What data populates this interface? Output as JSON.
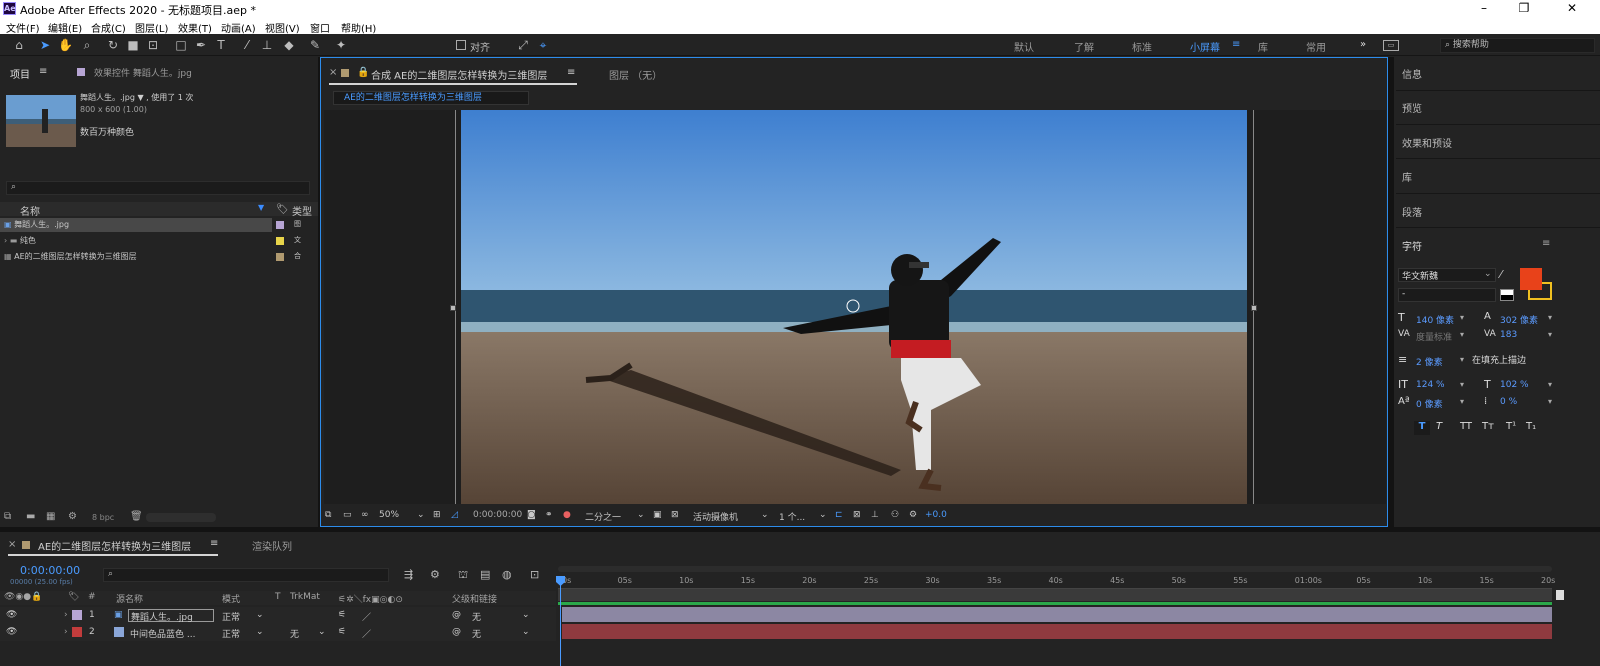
{
  "titlebar": {
    "app_title": "Adobe After Effects 2020 - 无标题项目.aep *",
    "logo_text": "Ae",
    "minimize": "–",
    "maximize": "❐",
    "close": "✕"
  },
  "menu": [
    "文件(F)",
    "编辑(E)",
    "合成(C)",
    "图层(L)",
    "效果(T)",
    "动画(A)",
    "视图(V)",
    "窗口",
    "帮助(H)"
  ],
  "toolbar": {
    "align_label": "对齐",
    "workspaces": [
      "默认",
      "了解",
      "标准",
      "小屏幕",
      "库",
      "常用"
    ],
    "active_workspace": "小屏幕",
    "more": "»",
    "search_placeholder": "搜索帮助"
  },
  "project": {
    "tab_label": "项目",
    "menu_icon": "≡",
    "effects_tab": "效果控件 舞蹈人生。jpg",
    "selected_name": "舞蹈人生。.jpg ▼ , 使用了 1 次",
    "selected_dims": "800 x 600 (1.00)",
    "selected_colors": "数百万种颜色",
    "search_icon": "⌕",
    "col_name": "名称",
    "col_type": "类型",
    "items": [
      {
        "name": "舞蹈人生。.jpg",
        "type": "图",
        "color": "#b7a5d4"
      },
      {
        "name": "纯色",
        "type": "文",
        "color": "#e8d44a"
      },
      {
        "name": "AE的二维图层怎样转换为三维图层",
        "type": "合",
        "color": "#b09a70"
      }
    ],
    "bpc": "8 bpc"
  },
  "composition": {
    "tab_label": "合成 AE的二维图层怎样转换为三维图层",
    "layer_tab": "图层 （无）",
    "subtab": "AE的二维图层怎样转换为三维图层",
    "menu_icon": "≡",
    "zoom": "50%",
    "timecode": "0:00:00:00",
    "resolution": "二分之一",
    "camera": "活动摄像机",
    "views": "1 个...",
    "exposure": "+0.0"
  },
  "right_panel": {
    "items": [
      "信息",
      "预览",
      "效果和预设",
      "库",
      "段落"
    ],
    "char_title": "字符",
    "font_name": "华文新魏",
    "font_style": "-",
    "fill_color": "#e8421a",
    "stroke_color": "#f0c020",
    "size": "140 像素",
    "leading": "302 像素",
    "kerning": "度量标准",
    "tracking": "183",
    "stroke_width": "2 像素",
    "stroke_mode": "在填充上描边",
    "vscale": "124 %",
    "hscale": "102 %",
    "baseline": "0 像素",
    "tsume": "0 %",
    "style_buttons": [
      "T",
      "T",
      "TT",
      "Tт",
      "T¹",
      "T₁"
    ]
  },
  "timeline": {
    "tab_label": "AE的二维图层怎样转换为三维图层",
    "render_tab": "渲染队列",
    "timecode": "0:00:00:00",
    "fps": "00000 (25.00 fps)",
    "col_source": "源名称",
    "col_mode": "模式",
    "col_t": "T",
    "col_trkmat": "TrkMat",
    "col_parent": "父级和链接",
    "col_hash": "#",
    "ticks": [
      "0s",
      "05s",
      "10s",
      "15s",
      "20s",
      "25s",
      "30s",
      "35s",
      "40s",
      "45s",
      "50s",
      "55s",
      "01:00s",
      "05s",
      "10s",
      "15s",
      "20s"
    ],
    "layers": [
      {
        "num": "1",
        "name": "舞蹈人生。.jpg",
        "mode": "正常",
        "trkmat": "",
        "parent": "无",
        "color": "#b7a5d4",
        "bar_color": "#8c87a3"
      },
      {
        "num": "2",
        "name": "中间色品蓝色 ...",
        "mode": "正常",
        "trkmat": "无",
        "parent": "无",
        "color": "#c23c3c",
        "bar_color": "#8f3a3f"
      }
    ]
  },
  "colors": {
    "accent": "#2d8ceb",
    "panel_bg": "#232323"
  }
}
